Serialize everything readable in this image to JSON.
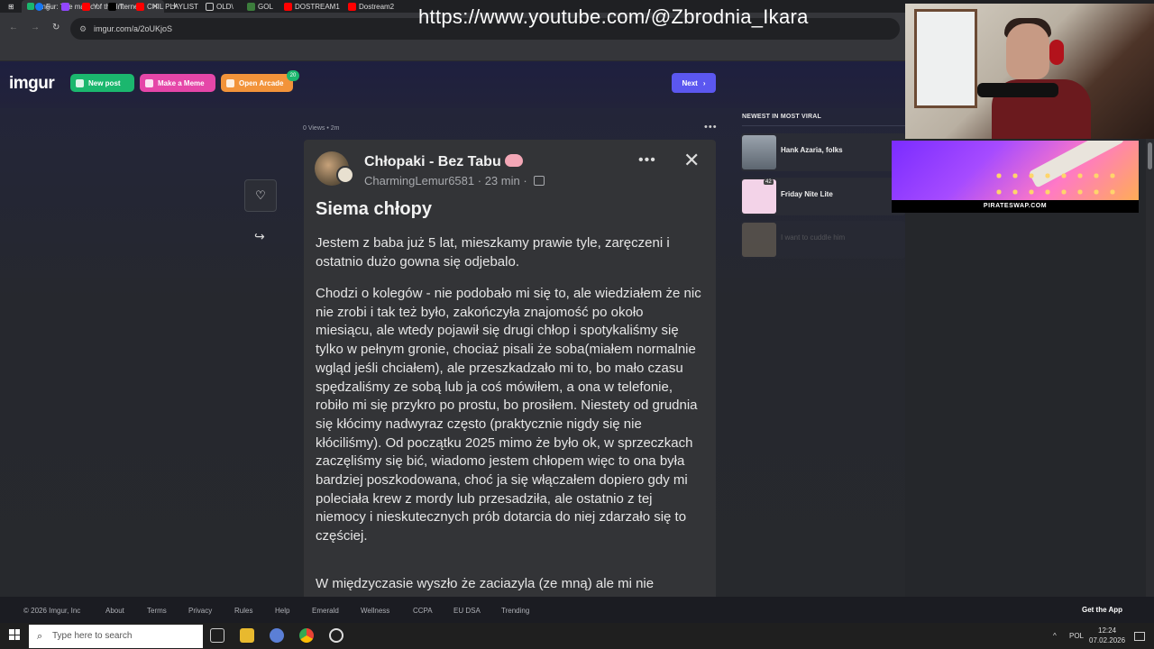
{
  "browser": {
    "tab_title": "Imgur: The magic of the Interne",
    "tab_close": "✕",
    "new_tab": "+",
    "tab_menu": "⌄",
    "url": "imgur.com/a/2oUKjoS",
    "bookmarks": [
      {
        "label": "F",
        "color": "#1877f2"
      },
      {
        "label": "",
        "color": "#9146ff"
      },
      {
        "label": "Y",
        "color": "#ff0000"
      },
      {
        "label": "T",
        "color": "#000000"
      },
      {
        "label": "CHIL PLAYLIST",
        "color": "#ff0000"
      },
      {
        "label": "OLD\\",
        "color": "#caa24b"
      },
      {
        "label": "GOL",
        "color": "#3c7d3c"
      },
      {
        "label": "DOSTREAM1",
        "color": "#ff0000"
      },
      {
        "label": "Dostream2",
        "color": "#ff0000"
      }
    ]
  },
  "overlay": {
    "watermark": "https://www.youtube.com/@Zbrodnia_Ikara",
    "ad_label": "PIRATESWAP.COM"
  },
  "header": {
    "logo": "imgur",
    "new_post": "New post",
    "make_meme": "Make a Meme",
    "open_arcade": "Open Arcade",
    "arcade_badge": "20",
    "next": "Next",
    "colors": {
      "new_post": "#1bb76e",
      "make_meme": "#e546a8",
      "open_arcade": "#f2933a",
      "next": "#5b57f0"
    }
  },
  "post": {
    "meta": "0 Views • 2m",
    "group": "Chłopaki - Bez Tabu",
    "author": "CharmingLemur6581",
    "time": "23 min",
    "title": "Siema chłopy",
    "paragraphs": [
      "Jestem z baba już 5 lat, mieszkamy prawie tyle, zaręczeni i ostatnio dużo gowna się odjebalo.",
      "Chodzi o kolegów - nie podobało mi się to, ale wiedziałem że nic nie zrobi i tak też było, zakończyła znajomość po około miesiącu, ale wtedy pojawił się drugi chłop i spotykaliśmy się tylko w pełnym gronie, chociaż pisali że soba(miałem normalnie wgląd jeśli chciałem), ale przeszkadzało mi to, bo mało czasu spędzaliśmy ze sobą lub ja coś mówiłem, a ona w telefonie, robiło mi się przykro po prostu, bo prosiłem. Niestety od grudnia się kłócimy nadwyraz często (praktycznie nigdy się nie kłóciliśmy). Od początku 2025 mimo że było ok, w sprzeczkach zaczęliśmy się bić, wiadomo jestem chłopem więc to ona była bardziej poszkodowana, choć ja się włączałem dopiero gdy mi poleciała krew z mordy lub przesadziła, ale ostatnio z tej niemocy i nieskutecznych prób dotarcia do niej zdarzało się to częściej.",
      "W międzyczasie wyszło że zaciazyla (ze mną) ale mi nie"
    ]
  },
  "sidebar": {
    "heading": "NEWEST IN MOST VIRAL",
    "items": [
      {
        "title": "Hank Azaria, folks",
        "badge": ""
      },
      {
        "title": "Friday Nite Lite",
        "badge": "42"
      },
      {
        "title": "I want to cuddle him",
        "badge": ""
      }
    ]
  },
  "footer": {
    "links": [
      "© 2026 Imgur, Inc",
      "About",
      "Terms",
      "Privacy",
      "Rules",
      "Help",
      "Emerald",
      "Wellness",
      "CCPA",
      "EU DSA",
      "Trending"
    ],
    "get_app": "Get the App"
  },
  "taskbar": {
    "search_placeholder": "Type here to search",
    "lang": "POL",
    "time": "12:24",
    "date": "07.02.2026"
  }
}
